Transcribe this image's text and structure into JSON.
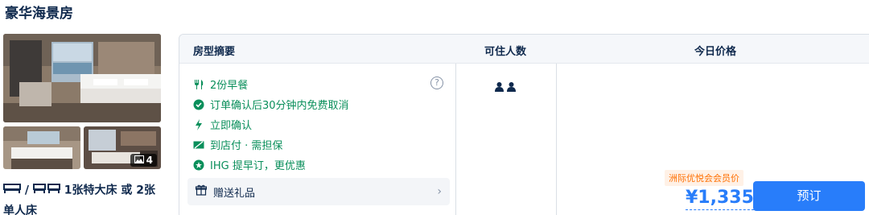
{
  "room": {
    "title": "豪华海景房",
    "photo_count": "4",
    "bed_description": "1张特大床 或 2张单人床"
  },
  "table": {
    "headers": {
      "room_summary": "房型摘要",
      "occupancy": "可住人数",
      "today_price": "今日价格"
    },
    "perks": [
      {
        "icon": "fork-knife-icon",
        "label": "2份早餐"
      },
      {
        "icon": "check-circle-icon",
        "label": "订单确认后30分钟内免费取消"
      },
      {
        "icon": "lightning-icon",
        "label": "立即确认"
      },
      {
        "icon": "pay-at-hotel-icon",
        "label": "到店付 · 需担保"
      },
      {
        "icon": "star-badge-icon",
        "label": "IHG 提早订，更优惠"
      }
    ],
    "help_symbol": "?",
    "gift": {
      "label": "赠送礼品",
      "chevron": "›"
    },
    "occupancy_persons": 2
  },
  "price": {
    "member_tag": "洲际优悦会会员价",
    "amount": "¥1,335",
    "book_label": "预订"
  },
  "colors": {
    "perk_green": "#0a8f5b",
    "accent_blue": "#287dfa",
    "member_orange": "#ff6f00"
  }
}
